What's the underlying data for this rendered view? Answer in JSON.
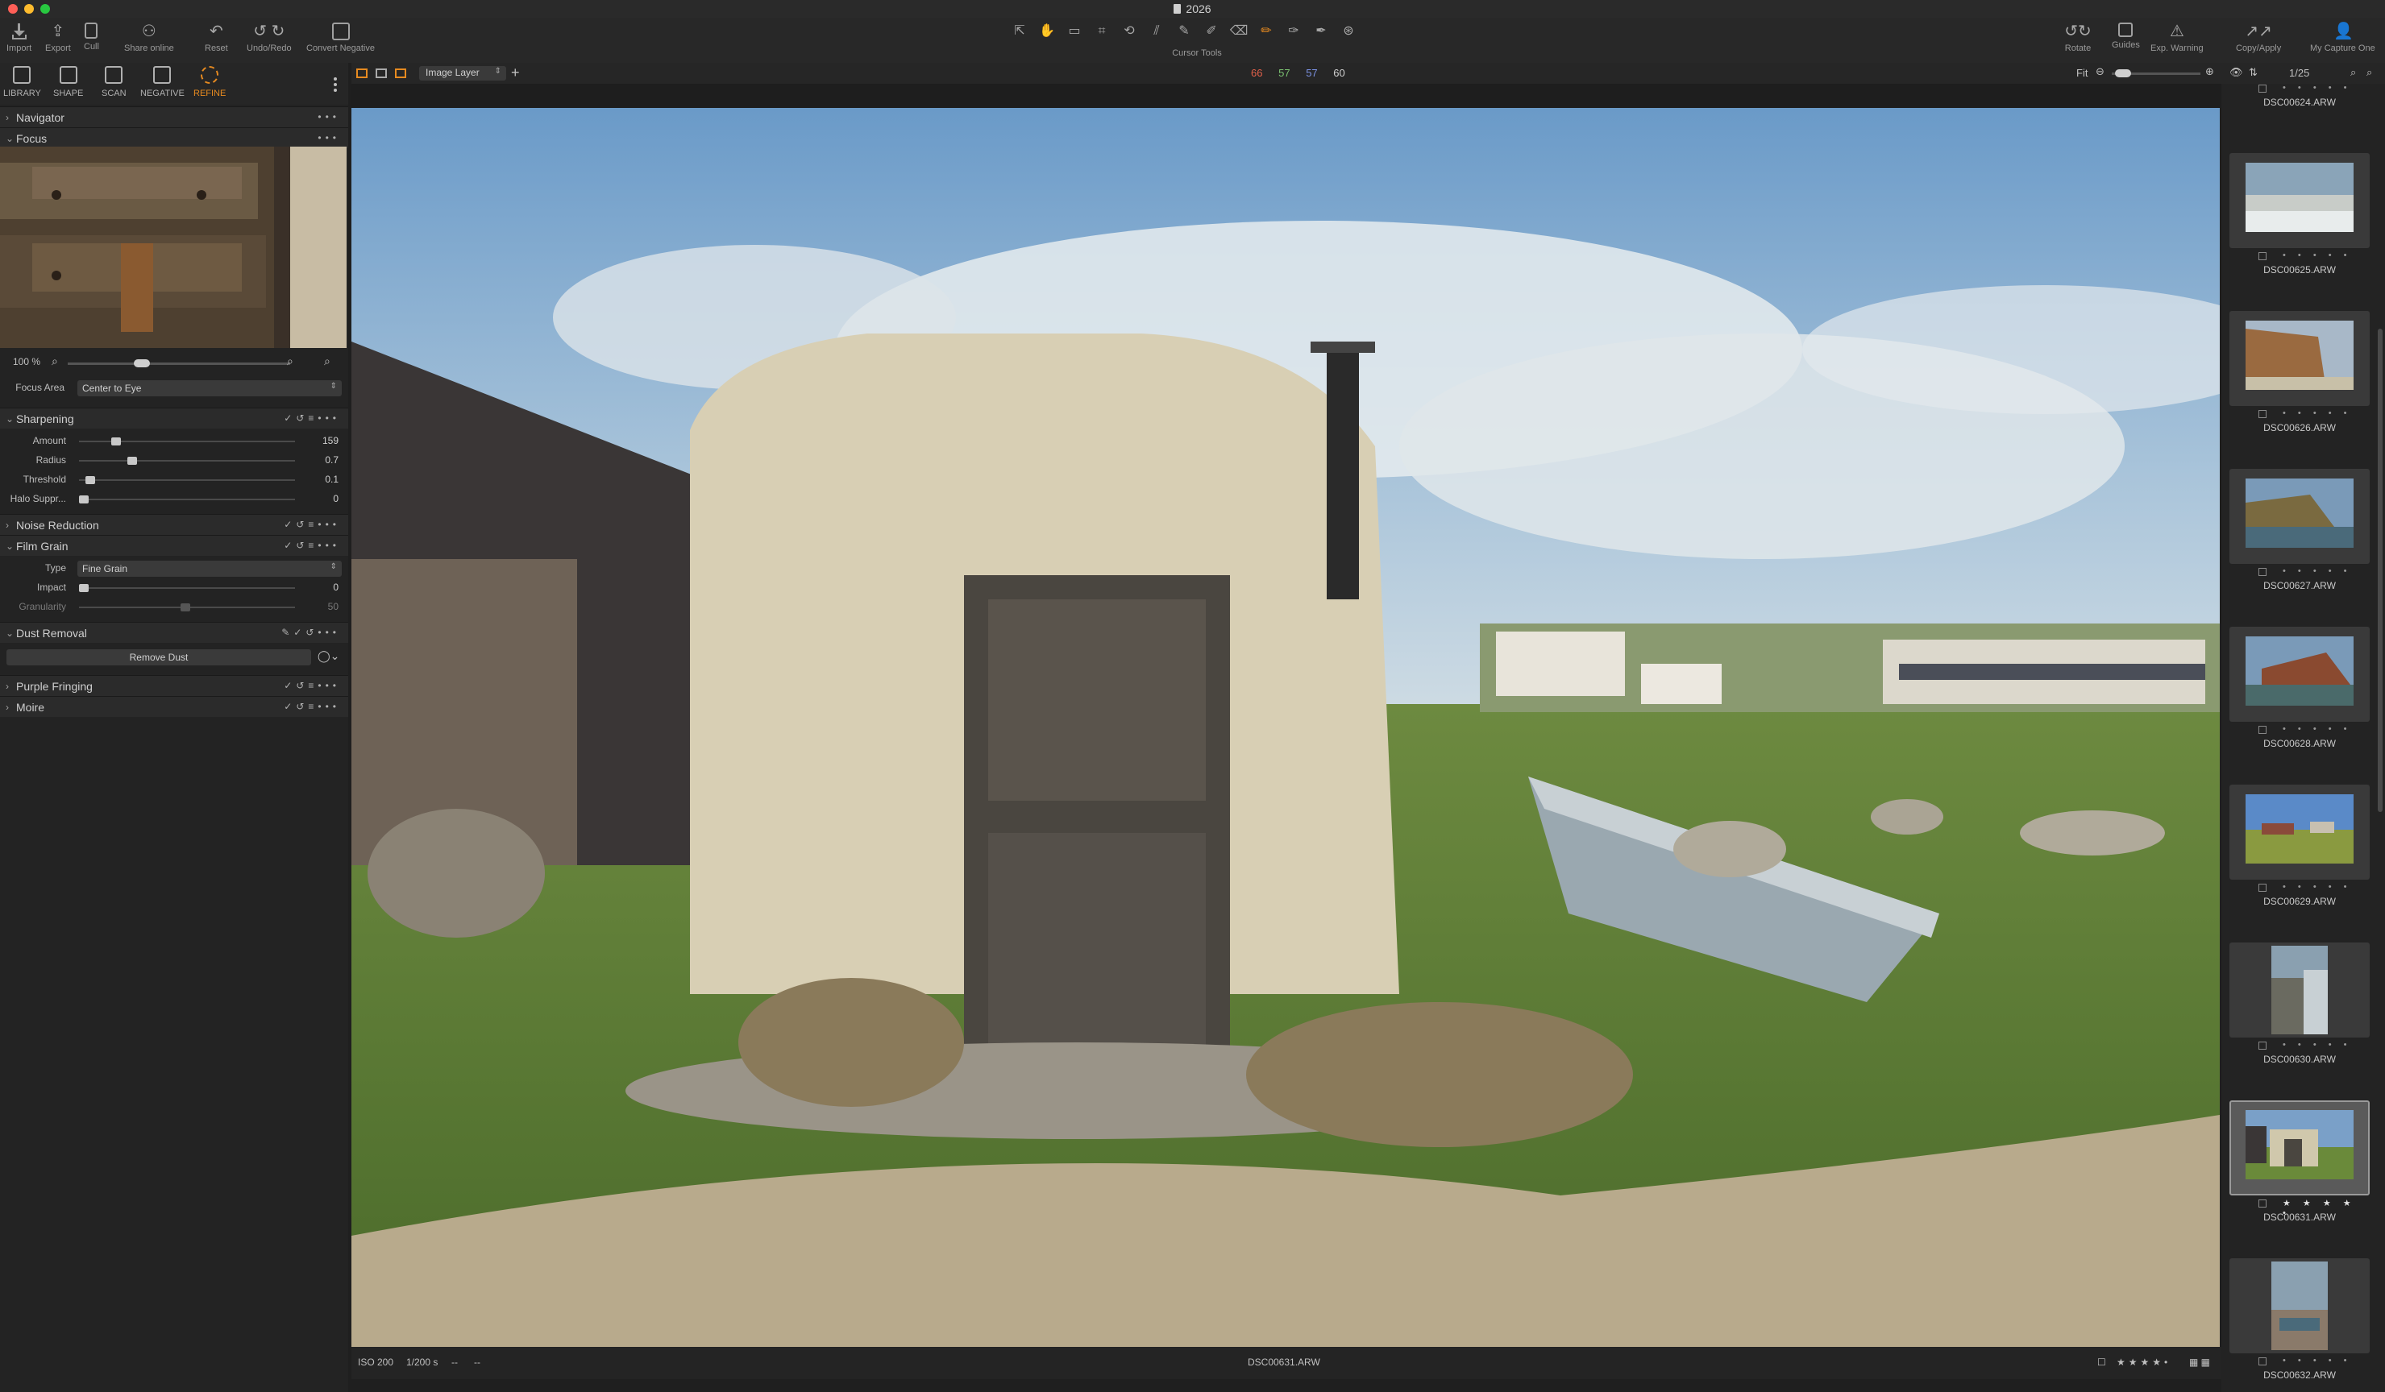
{
  "window": {
    "title": "2026"
  },
  "toolbar": {
    "left": [
      {
        "label": "Import",
        "icon": "import-icon"
      },
      {
        "label": "Export",
        "icon": "export-icon"
      },
      {
        "label": "Cull",
        "icon": "cull-icon"
      },
      {
        "label": "Share online",
        "icon": "share-icon"
      },
      {
        "label": "Reset",
        "icon": "reset-icon"
      },
      {
        "label": "Undo/Redo",
        "icon": "undo-icon"
      },
      {
        "label": "Convert Negative",
        "icon": "convert-negative-icon"
      }
    ],
    "cursor_tools_label": "Cursor Tools",
    "right": [
      {
        "label": "Rotate",
        "icon": "rotate-icon"
      },
      {
        "label": "Guides",
        "icon": "guides-icon"
      },
      {
        "label": "Exp. Warning",
        "icon": "warning-icon"
      },
      {
        "label": "Copy/Apply",
        "icon": "copy-apply-icon"
      },
      {
        "label": "My Capture One",
        "icon": "user-icon"
      }
    ]
  },
  "viewer_bar": {
    "layer": "Image Layer",
    "rgb": {
      "r": "66",
      "g": "57",
      "b": "57",
      "l": "60"
    },
    "zoom_label": "Fit"
  },
  "left_tabs": [
    {
      "label": "LIBRARY"
    },
    {
      "label": "SHAPE"
    },
    {
      "label": "SCAN"
    },
    {
      "label": "NEGATIVE"
    },
    {
      "label": "REFINE",
      "active": true
    }
  ],
  "panel": {
    "navigator": "Navigator",
    "focus": {
      "title": "Focus",
      "zoom": "100 %",
      "area_label": "Focus Area",
      "area_value": "Center to Eye"
    },
    "sharpening": {
      "title": "Sharpening",
      "params": [
        {
          "label": "Amount",
          "value": "159",
          "pos": 0.1
        },
        {
          "label": "Radius",
          "value": "0.7",
          "pos": 0.23
        },
        {
          "label": "Threshold",
          "value": "0.1",
          "pos": 0.03
        },
        {
          "label": "Halo Suppr...",
          "value": "0",
          "pos": 0.0
        }
      ]
    },
    "noise_reduction": "Noise Reduction",
    "film_grain": {
      "title": "Film Grain",
      "type_label": "Type",
      "type_value": "Fine Grain",
      "params": [
        {
          "label": "Impact",
          "value": "0",
          "pos": 0.0
        },
        {
          "label": "Granularity",
          "value": "50",
          "pos": 0.5
        }
      ]
    },
    "dust_removal": {
      "title": "Dust Removal",
      "button": "Remove Dust"
    },
    "purple_fringing": "Purple Fringing",
    "moire": "Moire"
  },
  "status": {
    "iso": "ISO 200",
    "shutter": "1/200 s",
    "dash1": "--",
    "dash2": "--",
    "filename": "DSC00631.ARW"
  },
  "filmstrip": {
    "counter": "1/25",
    "items": [
      {
        "name": "DSC00624.ARW",
        "stars": 0
      },
      {
        "name": "DSC00625.ARW",
        "stars": 0
      },
      {
        "name": "DSC00626.ARW",
        "stars": 0
      },
      {
        "name": "DSC00627.ARW",
        "stars": 0
      },
      {
        "name": "DSC00628.ARW",
        "stars": 0
      },
      {
        "name": "DSC00629.ARW",
        "stars": 0
      },
      {
        "name": "DSC00630.ARW",
        "stars": 0
      },
      {
        "name": "DSC00631.ARW",
        "stars": 4,
        "selected": true
      },
      {
        "name": "DSC00632.ARW",
        "stars": 0
      }
    ]
  },
  "colors": {
    "accent": "#e68a20",
    "r": "#e0604a",
    "g": "#7ac070",
    "b": "#7a90e0"
  }
}
